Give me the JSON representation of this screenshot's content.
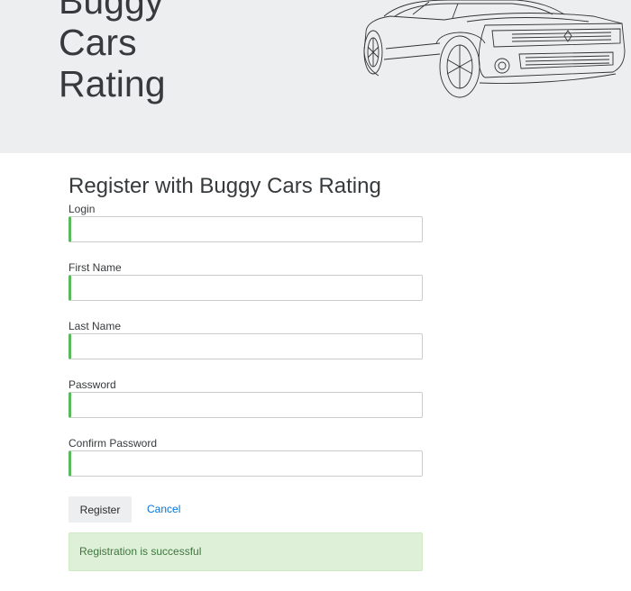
{
  "header": {
    "brand_line1": "Buggy",
    "brand_line2": "Cars",
    "brand_line3": "Rating",
    "background": "#eceeef"
  },
  "form": {
    "title": "Register with Buggy Cars Rating",
    "fields": [
      {
        "label": "Login",
        "value": "",
        "placeholder": ""
      },
      {
        "label": "First Name",
        "value": "",
        "placeholder": ""
      },
      {
        "label": "Last Name",
        "value": "",
        "placeholder": ""
      },
      {
        "label": "Password",
        "value": "",
        "placeholder": ""
      },
      {
        "label": "Confirm Password",
        "value": "",
        "placeholder": ""
      }
    ],
    "valid_color": "#5cb85c",
    "register_label": "Register",
    "cancel_label": "Cancel"
  },
  "alert": {
    "message": "Registration is successful",
    "background": "#dff0d8",
    "text_color": "#3c763d"
  }
}
